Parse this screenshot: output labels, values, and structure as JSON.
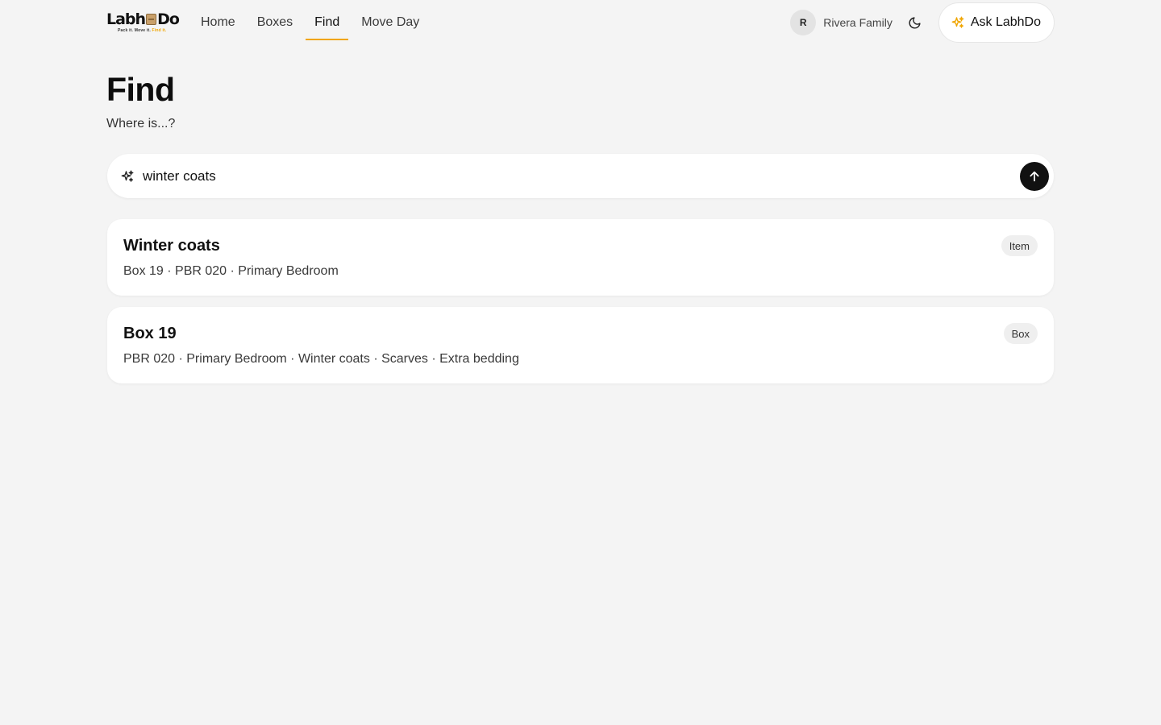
{
  "brand": {
    "name_left": "Labh",
    "name_right": "Do",
    "tagline_a": "Pack it. Move it.",
    "tagline_b": "Find it."
  },
  "nav": {
    "items": [
      {
        "label": "Home"
      },
      {
        "label": "Boxes"
      },
      {
        "label": "Find",
        "active": true
      },
      {
        "label": "Move Day"
      }
    ]
  },
  "user": {
    "initial": "R",
    "family_name": "Rivera Family"
  },
  "ask_button": {
    "label": "Ask LabhDo"
  },
  "page": {
    "title": "Find",
    "subtitle": "Where is...?"
  },
  "search": {
    "value": "winter coats",
    "placeholder": "",
    "submit_icon": "arrow-up-icon"
  },
  "results": [
    {
      "title": "Winter coats",
      "meta": "Box 19 · PBR 020 · Primary Bedroom",
      "badge": "Item"
    },
    {
      "title": "Box 19",
      "meta": "PBR 020 · Primary Bedroom · Winter coats · Scarves · Extra bedding",
      "badge": "Box"
    }
  ],
  "colors": {
    "accent": "#f0a500",
    "background": "#f4f4f4",
    "card": "#ffffff",
    "primary_button": "#111111"
  }
}
